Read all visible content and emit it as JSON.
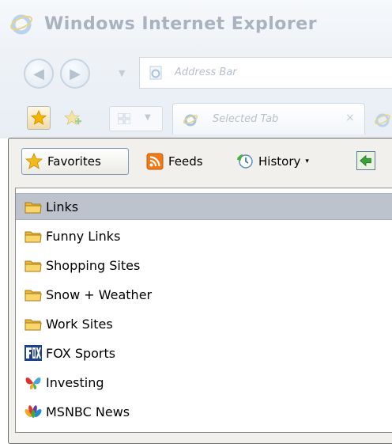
{
  "window": {
    "title": "Windows Internet Explorer",
    "address_placeholder": "Address Bar",
    "selected_tab_label": "Selected Tab",
    "tab_close_glyph": "×"
  },
  "favorites_center": {
    "toolbar": {
      "favorites_label": "Favorites",
      "feeds_label": "Feeds",
      "history_label": "History",
      "history_arrow": "▾"
    },
    "items": [
      {
        "label": "Links",
        "icon": "folder-icon",
        "selected": true
      },
      {
        "label": "Funny Links",
        "icon": "folder-icon",
        "selected": false
      },
      {
        "label": "Shopping Sites",
        "icon": "folder-icon",
        "selected": false
      },
      {
        "label": "Snow + Weather",
        "icon": "folder-icon",
        "selected": false
      },
      {
        "label": "Work Sites",
        "icon": "folder-icon",
        "selected": false
      },
      {
        "label": "FOX Sports",
        "icon": "fox-logo-icon",
        "selected": false
      },
      {
        "label": "Investing",
        "icon": "msn-butterfly-icon",
        "selected": false
      },
      {
        "label": "MSNBC News",
        "icon": "msnbc-peacock-icon",
        "selected": false
      }
    ]
  },
  "colors": {
    "selection_background": "#bdc3cd",
    "folder_yellow": "#f5c84a",
    "feed_orange": "#f07a1a"
  }
}
